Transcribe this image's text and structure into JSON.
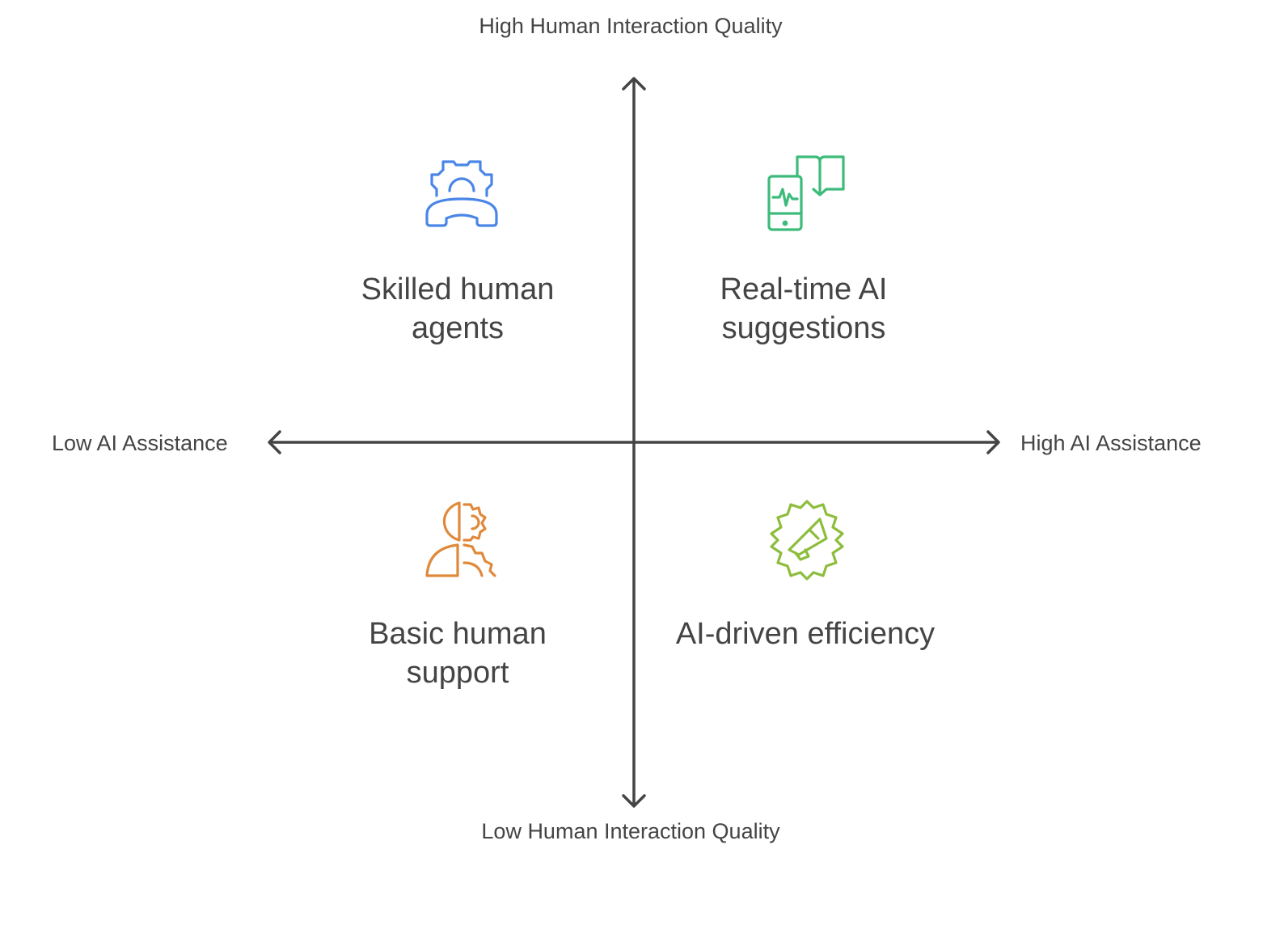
{
  "axes": {
    "y_top_label": "High Human Interaction Quality",
    "y_bottom_label": "Low Human Interaction Quality",
    "x_left_label": "Low AI Assistance",
    "x_right_label": "High AI Assistance"
  },
  "quadrants": {
    "top_left": {
      "label": "Skilled human agents",
      "icon": "headset-gear-icon",
      "color": "#4a86e8"
    },
    "top_right": {
      "label": "Real-time AI suggestions",
      "icon": "phone-book-icon",
      "color": "#3dbb7a"
    },
    "bottom_left": {
      "label": "Basic human support",
      "icon": "human-gear-icon",
      "color": "#e0893a"
    },
    "bottom_right": {
      "label": "AI-driven efficiency",
      "icon": "gear-megaphone-icon",
      "color": "#8dbd3c"
    }
  },
  "axis_color": "#444444"
}
